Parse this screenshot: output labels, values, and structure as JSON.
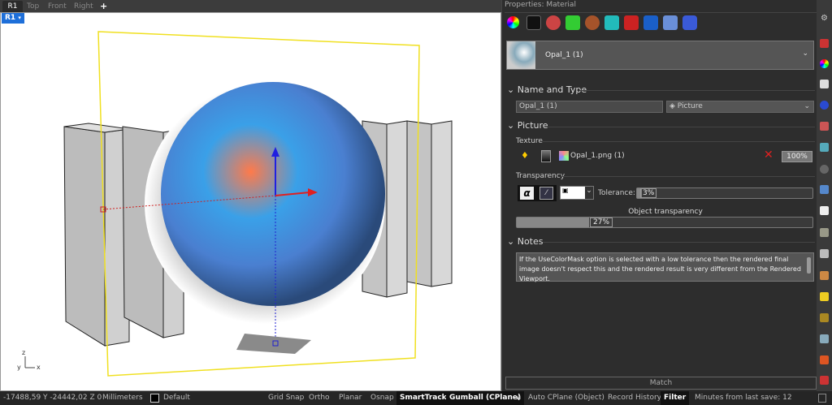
{
  "viewport_tabs": [
    "R1",
    "Top",
    "Front",
    "Right"
  ],
  "add_tab": "+",
  "viewport_label": "R1",
  "axes": {
    "z": "z",
    "x": "x",
    "y": "y"
  },
  "panel": {
    "title": "Properties: Material",
    "toolbar_icons": [
      "color-wheel-icon",
      "paint-icon",
      "render-content-icon",
      "texture-icon",
      "wood-ball-icon",
      "cube-icon",
      "red-box-icon",
      "vray-icon",
      "box-icon",
      "cylinder-icon"
    ],
    "material_name": "Opal_1 (1)",
    "name_and_type": {
      "header": "Name and Type",
      "name": "Opal_1 (1)",
      "type": "Picture"
    },
    "picture": {
      "header": "Picture",
      "texture_label": "Texture",
      "texture_file": "Opal_1.png (1)",
      "texture_amount": "100%",
      "transparency_label": "Transparency",
      "tolerance_label": "Tolerance:",
      "tolerance": "3%",
      "tolerance_value": 3,
      "object_transparency_label": "Object transparency",
      "object_transparency": "27%",
      "object_transparency_value": 27
    },
    "notes": {
      "header": "Notes",
      "text": "If the UseColorMask option is selected with a low tolerance then the rendered final image doesn't respect this and the rendered result is very different from the Rendered Viewport."
    },
    "match_button": "Match"
  },
  "status": {
    "coords": "-17488,59 Y -24442,02 Z 0",
    "units": "Millimeters",
    "layer": "Default",
    "grid_snap": "Grid Snap",
    "ortho": "Ortho",
    "planar": "Planar",
    "osnap": "Osnap",
    "smarttrack": "SmartTrack",
    "gumball": "Gumball (CPlane)",
    "auto_cplane": "Auto CPlane (Object)",
    "record_history": "Record History",
    "filter": "Filter",
    "save": "Minutes from last save: 12"
  }
}
